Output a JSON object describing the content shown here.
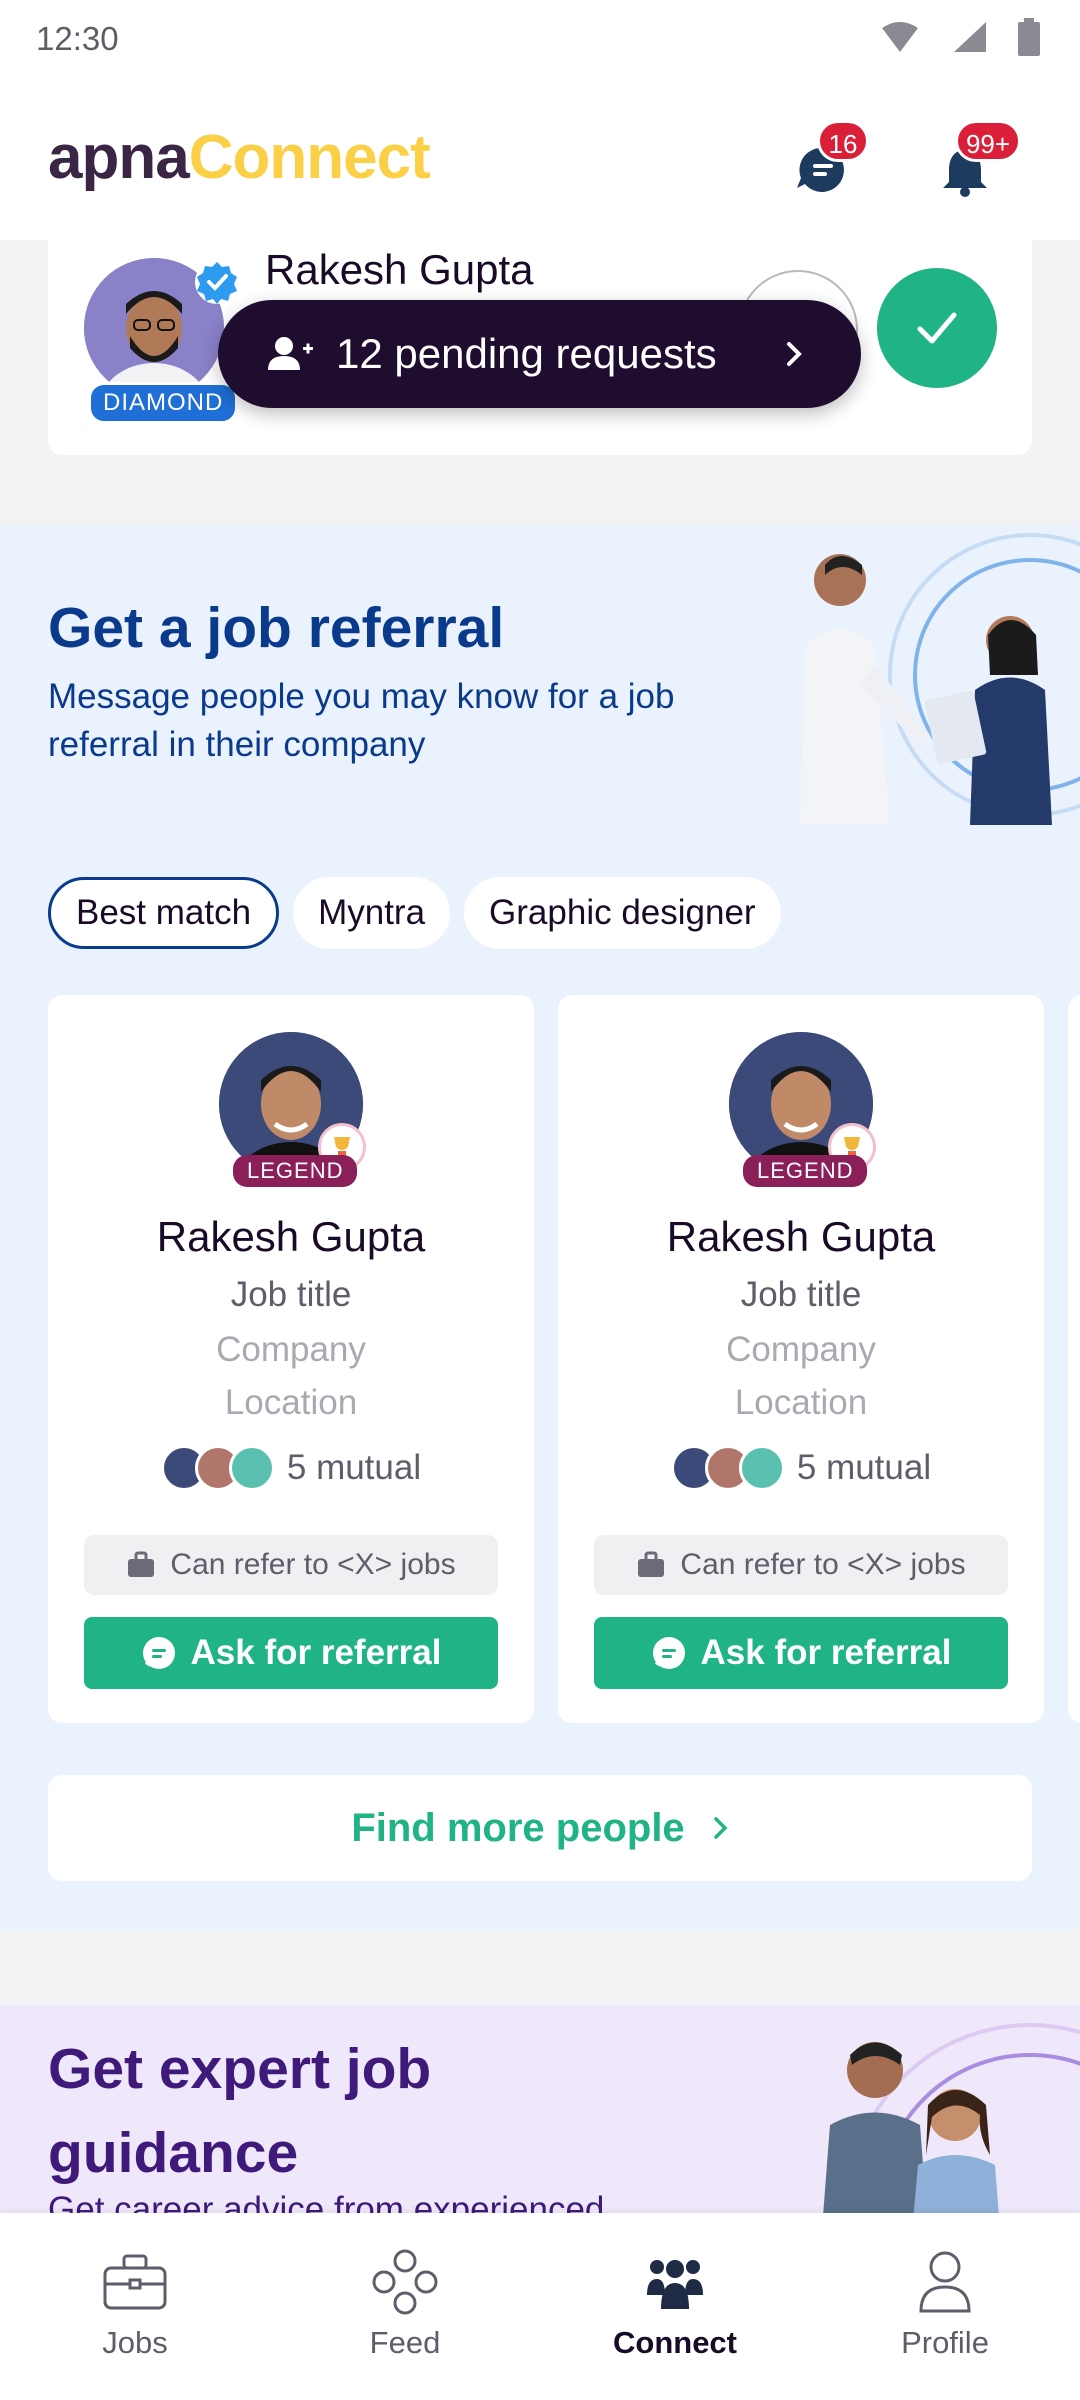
{
  "status_bar": {
    "time": "12:30"
  },
  "header": {
    "brand_part1": "apna",
    "brand_part2": "Connect",
    "messages_badge": "16",
    "notifications_badge": "99+"
  },
  "top_card": {
    "name": "Rakesh Gupta",
    "tier_badge": "DIAMOND",
    "pending_label": "12 pending requests"
  },
  "referral": {
    "title": "Get a job referral",
    "subtitle": "Message people you may know for a job referral in their company",
    "chips": [
      "Best match",
      "Myntra",
      "Graphic designer"
    ],
    "people": [
      {
        "badge": "LEGEND",
        "name": "Rakesh Gupta",
        "title": "Job title",
        "company": "Company",
        "location": "Location",
        "mutual": "5 mutual",
        "refer_text": "Can refer to <X> jobs",
        "cta": "Ask for referral"
      },
      {
        "badge": "LEGEND",
        "name": "Rakesh Gupta",
        "title": "Job title",
        "company": "Company",
        "location": "Location",
        "mutual": "5 mutual",
        "refer_text": "Can refer to <X> jobs",
        "cta": "Ask for referral"
      }
    ],
    "find_more": "Find more people"
  },
  "expert": {
    "title": "Get expert job guidance",
    "subtitle": "Get career advice from experienced"
  },
  "bottom_nav": {
    "items": [
      {
        "label": "Jobs",
        "icon": "briefcase-icon"
      },
      {
        "label": "Feed",
        "icon": "feed-icon"
      },
      {
        "label": "Connect",
        "icon": "people-icon"
      },
      {
        "label": "Profile",
        "icon": "profile-icon"
      }
    ],
    "active": "Connect"
  },
  "colors": {
    "green": "#1fb386",
    "navy": "#0a3a8c",
    "brand_yellow": "#fbcf46",
    "badge_red": "#d92038"
  }
}
